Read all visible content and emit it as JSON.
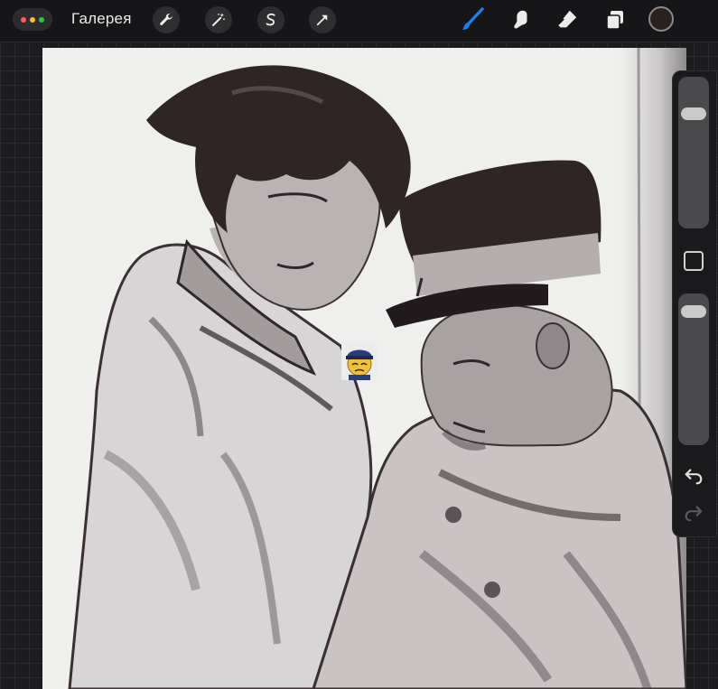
{
  "toolbar": {
    "gallery_label": "Галерея",
    "left_tools": [
      "wrench-icon",
      "magic-wand-icon",
      "selection-icon",
      "transform-arrow-icon"
    ],
    "right_tools": [
      "brush-icon",
      "smudge-icon",
      "eraser-icon",
      "layers-icon"
    ],
    "active_tool": "brush-icon",
    "current_color": "#2a2020",
    "accent_color": "#1f7ef0"
  },
  "sidebar": {
    "brush_size_level": 0.2,
    "opacity_level": 0.05,
    "controls": [
      "brush-size-slider",
      "modify-button",
      "opacity-slider",
      "undo-icon",
      "redo-icon"
    ]
  }
}
